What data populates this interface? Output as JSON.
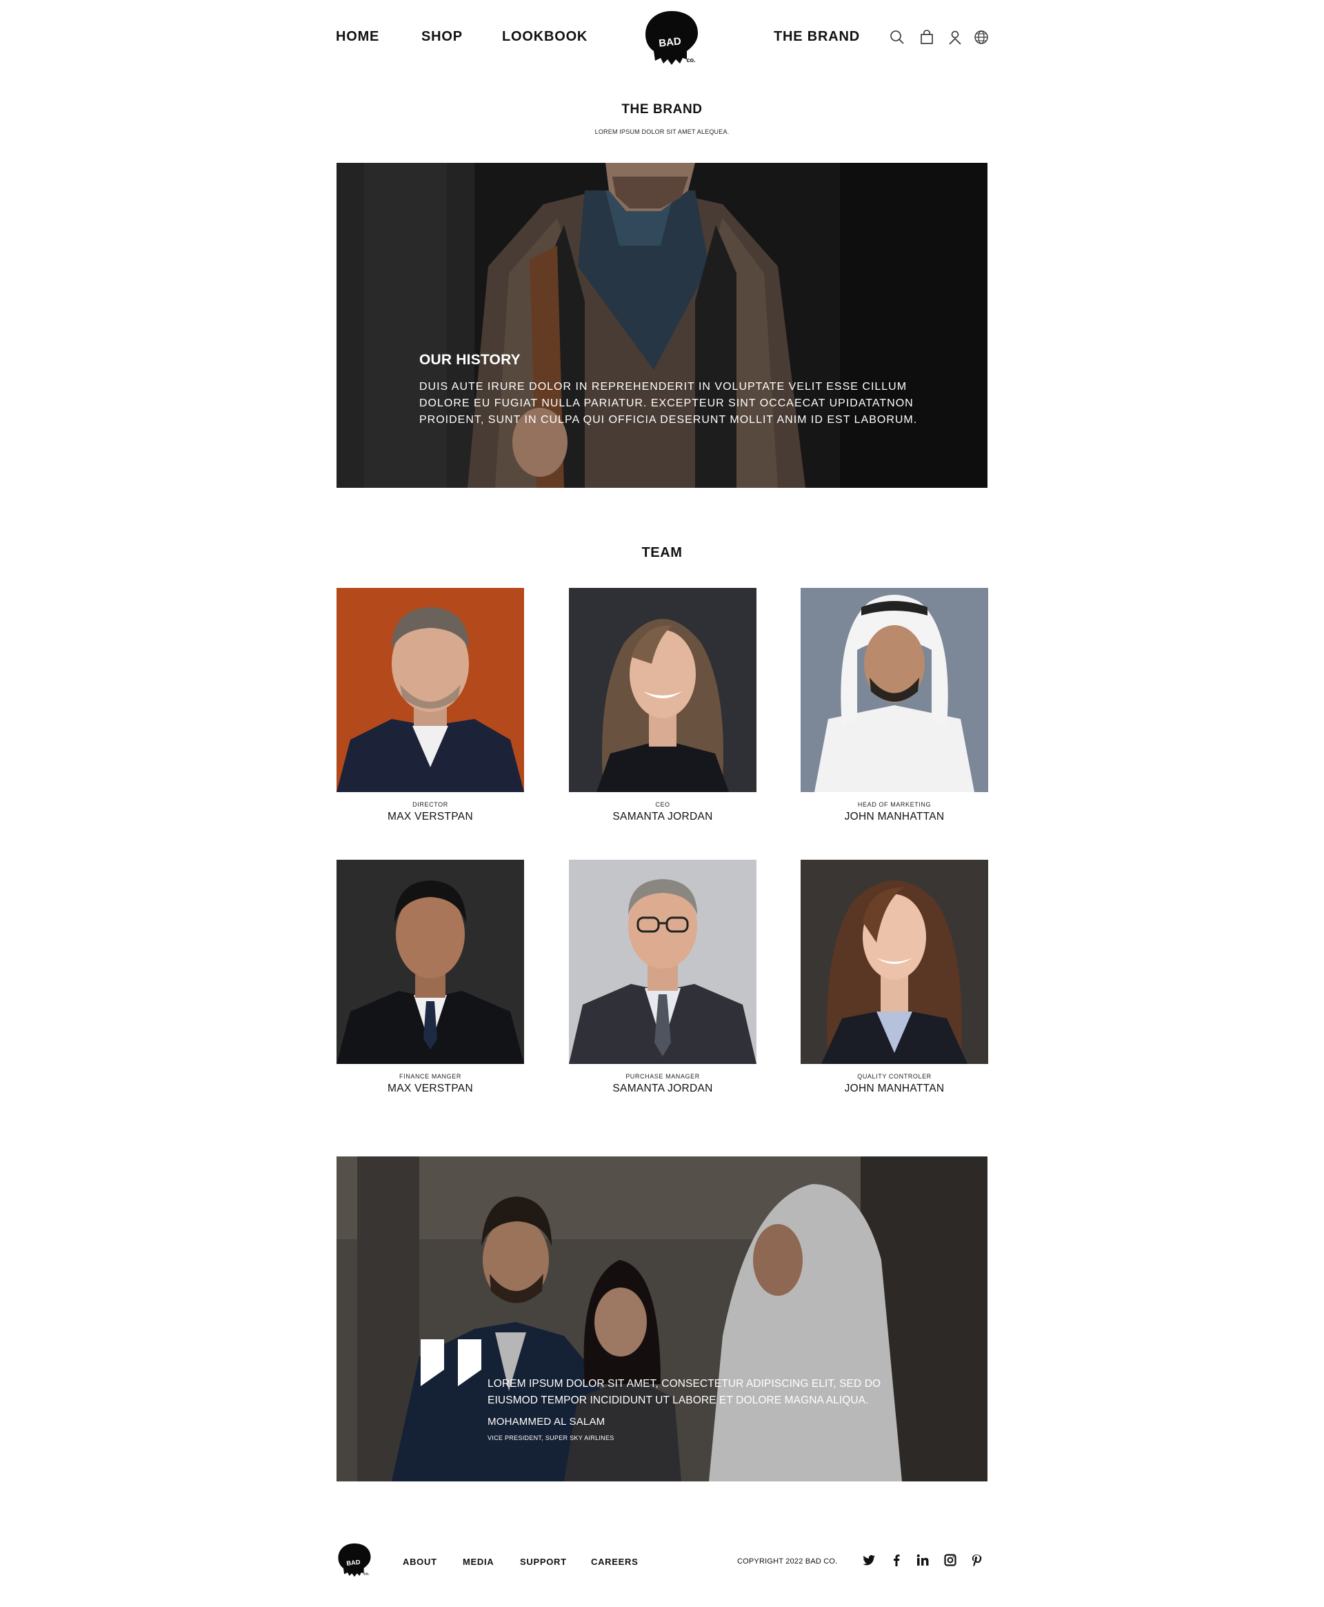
{
  "header": {
    "nav": [
      {
        "label": "HOME"
      },
      {
        "label": "SHOP"
      },
      {
        "label": "LOOKBOOK"
      },
      {
        "label": "THE BRAND"
      }
    ],
    "logo_text": "BAD",
    "logo_suffix": "co.",
    "icons": [
      "search-icon",
      "shopping-bag-icon",
      "user-icon",
      "globe-icon"
    ]
  },
  "brand": {
    "title": "THE BRAND",
    "subtitle": "LOREM IPSUM DOLOR SIT AMET ALEQUEA."
  },
  "history": {
    "title": "OUR HISTORY",
    "text": "DUIS AUTE IRURE DOLOR IN REPREHENDERIT IN VOLUPTATE VELIT ESSE CILLUM DOLORE EU FUGIAT NULLA PARIATUR. EXCEPTEUR SINT OCCAECAT UPIDATATNON PROIDENT, SUNT IN CULPA QUI OFFICIA DESERUNT MOLLIT ANIM ID EST LABORUM."
  },
  "team": {
    "title": "TEAM",
    "members": [
      {
        "role": "DIRECTOR",
        "name": "MAX VERSTPAN"
      },
      {
        "role": "CEO",
        "name": "SAMANTA JORDAN"
      },
      {
        "role": "HEAD OF MARKETING",
        "name": "JOHN MANHATTAN"
      },
      {
        "role": "FINANCE MANGER",
        "name": "MAX VERSTPAN"
      },
      {
        "role": "PURCHASE MANAGER",
        "name": "SAMANTA JORDAN"
      },
      {
        "role": "QUALITY CONTROLER",
        "name": "JOHN MANHATTAN"
      }
    ]
  },
  "testimonial": {
    "quote": "LOREM IPSUM DOLOR SIT AMET, CONSECTETUR ADIPISCING ELIT, SED DO EIUSMOD TEMPOR INCIDIDUNT UT LABORE ET DOLORE MAGNA ALIQUA.",
    "author": "MOHAMMED AL SALAM",
    "author_role": "VICE PRESIDENT, SUPER SKY AIRLINES"
  },
  "footer": {
    "links": [
      {
        "label": "ABOUT"
      },
      {
        "label": "MEDIA"
      },
      {
        "label": "SUPPORT"
      },
      {
        "label": "CAREERS"
      }
    ],
    "copyright": "COPYRIGHT 2022 BAD CO.",
    "social": [
      "twitter-icon",
      "facebook-icon",
      "linkedin-icon",
      "instagram-icon",
      "pinterest-icon"
    ]
  }
}
